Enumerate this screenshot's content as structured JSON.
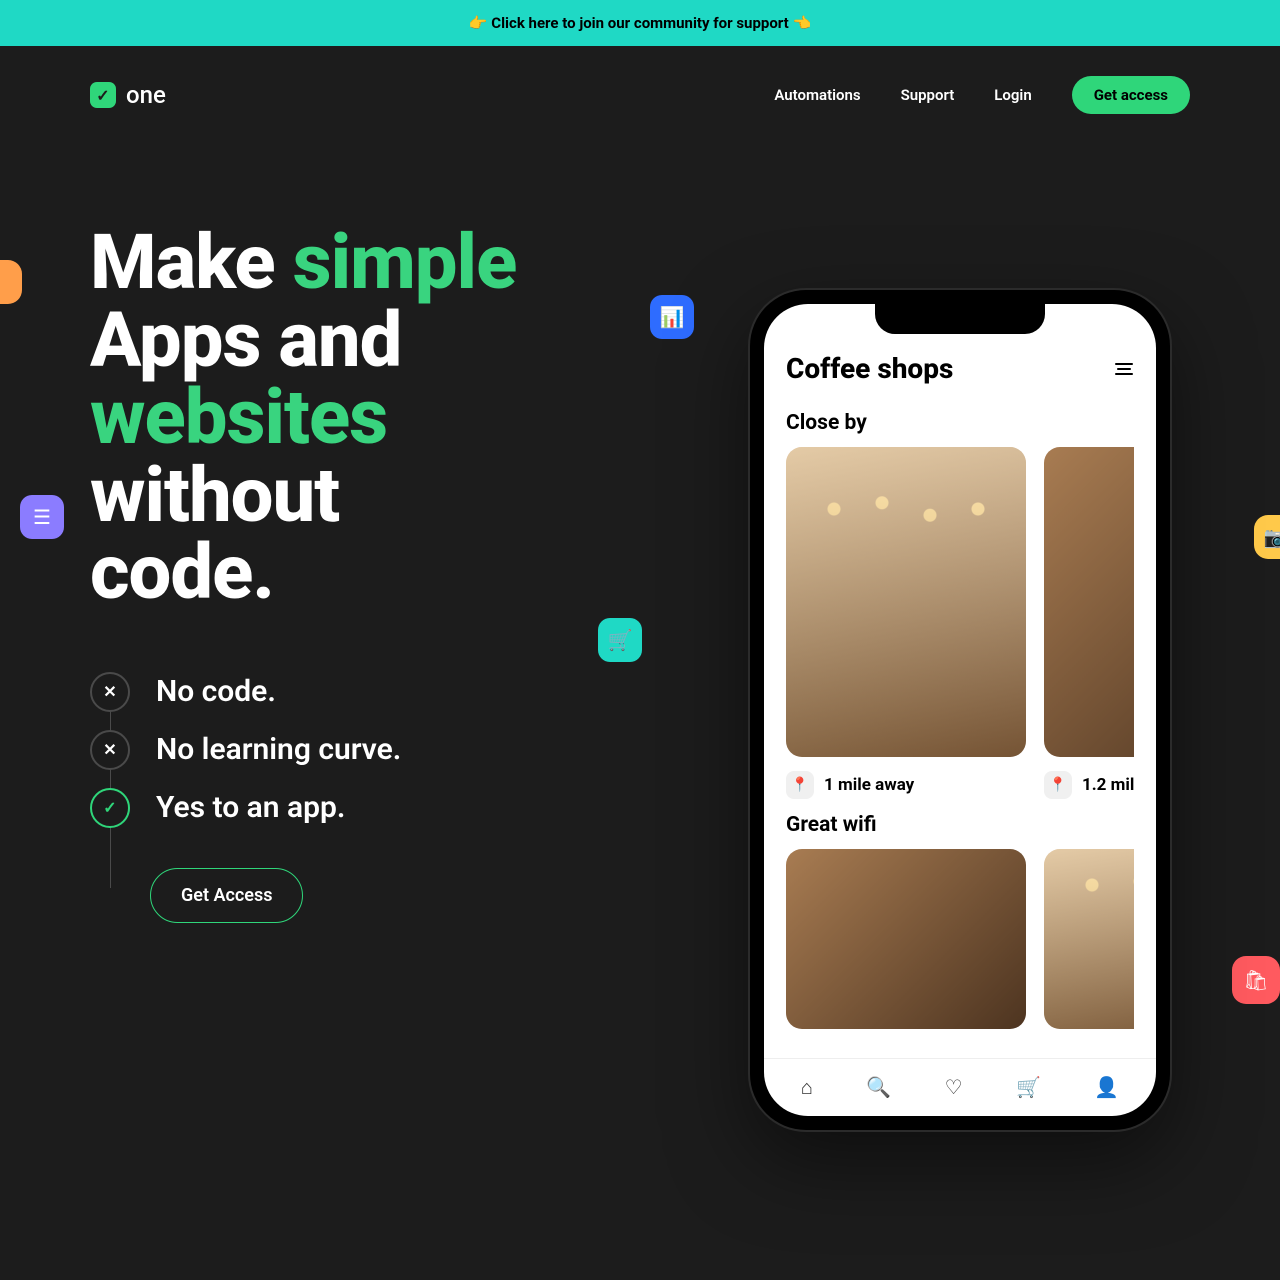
{
  "banner": {
    "text": "👉 Click here to join our community for support 👈"
  },
  "brand": {
    "name": "one"
  },
  "nav": {
    "items": [
      "Automations",
      "Support",
      "Login"
    ],
    "cta": "Get access"
  },
  "hero": {
    "title": {
      "l1a": "Make ",
      "l1b": "simple",
      "l2": "Apps and",
      "l3a": "websites",
      "l3b": " without",
      "l4": "code."
    },
    "bullets": [
      {
        "icon": "✕",
        "text": "No code."
      },
      {
        "icon": "✕",
        "text": "No learning curve."
      },
      {
        "icon": "✓",
        "text": "Yes to an app."
      }
    ],
    "cta": "Get Access"
  },
  "floats": {
    "chart": "📊",
    "list": "☰",
    "cart": "🛒",
    "camera": "📷",
    "bag": "🛍"
  },
  "phone": {
    "title": "Coffee shops",
    "section1": "Close by",
    "card1_dist": "1 mile away",
    "card2_dist": "1.2 mil",
    "section2": "Great wifi",
    "tabs": [
      "⌂",
      "🔍",
      "♡",
      "🛒",
      "👤"
    ]
  }
}
